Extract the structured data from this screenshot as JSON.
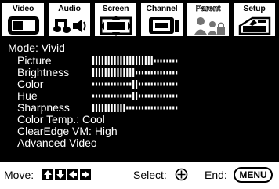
{
  "tabs": [
    {
      "label": "Video",
      "icon": "video-screen-icon",
      "state": "selected"
    },
    {
      "label": "Audio",
      "icon": "music-notes-icon",
      "state": "normal"
    },
    {
      "label": "Screen",
      "icon": "screen-zoom-icon",
      "state": "normal"
    },
    {
      "label": "Channel",
      "icon": "channel-list-icon",
      "state": "normal"
    },
    {
      "label": "Parent",
      "icon": "parental-lock-icon",
      "state": "faded"
    },
    {
      "label": "Setup",
      "icon": "setup-toolbox-icon",
      "state": "normal"
    }
  ],
  "settings": {
    "mode_line": "Mode: Vivid",
    "sliders": [
      {
        "label": "Picture",
        "level": 0.7,
        "style": "fill"
      },
      {
        "label": "Brightness",
        "level": 0.5,
        "style": "fill"
      },
      {
        "label": "Color",
        "level": 0.5,
        "style": "center"
      },
      {
        "label": "Hue",
        "level": 0.5,
        "style": "center"
      },
      {
        "label": "Sharpness",
        "level": 0.4,
        "style": "fill"
      }
    ],
    "color_temp": "Color Temp.: Cool",
    "clearedge": "ClearEdge VM: High",
    "advanced": "Advanced Video"
  },
  "footer": {
    "move_label": "Move:",
    "select_label": "Select:",
    "end_label": "End:",
    "menu_button": "MENU"
  },
  "colors": {
    "background": "#000000",
    "text": "#ffffff",
    "footer_bg": "#ffffff"
  }
}
